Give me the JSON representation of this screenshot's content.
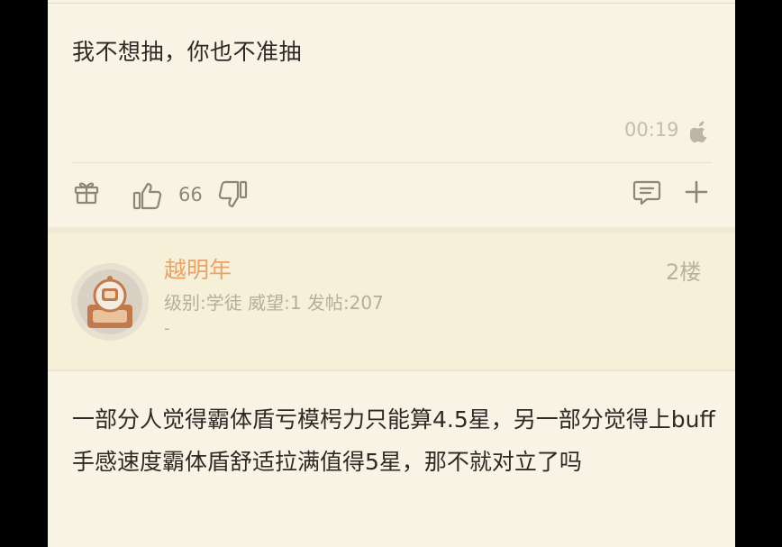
{
  "post1": {
    "text": "我不想抽，你也不准抽",
    "time": "00:19",
    "device_icon": "apple-icon",
    "like_count": "66"
  },
  "post2": {
    "username": "越明年",
    "floor": "2楼",
    "meta": "级别:学徒 威望:1 发帖:207",
    "signature": "-",
    "text": "一部分人觉得霸体盾亏模枵力只能算4.5星，另一部分觉得上buff手感速度霸体盾舒适拉满值得5星，那不就对立了吗"
  },
  "icons": [
    "gift-icon",
    "like-icon",
    "dislike-icon",
    "comment-icon",
    "plus-icon",
    "apple-icon",
    "avatar"
  ],
  "colors": {
    "background": "#f8f3e4",
    "username": "#e7a36a",
    "text": "#2c2a26",
    "muted": "#b6ae9d"
  }
}
